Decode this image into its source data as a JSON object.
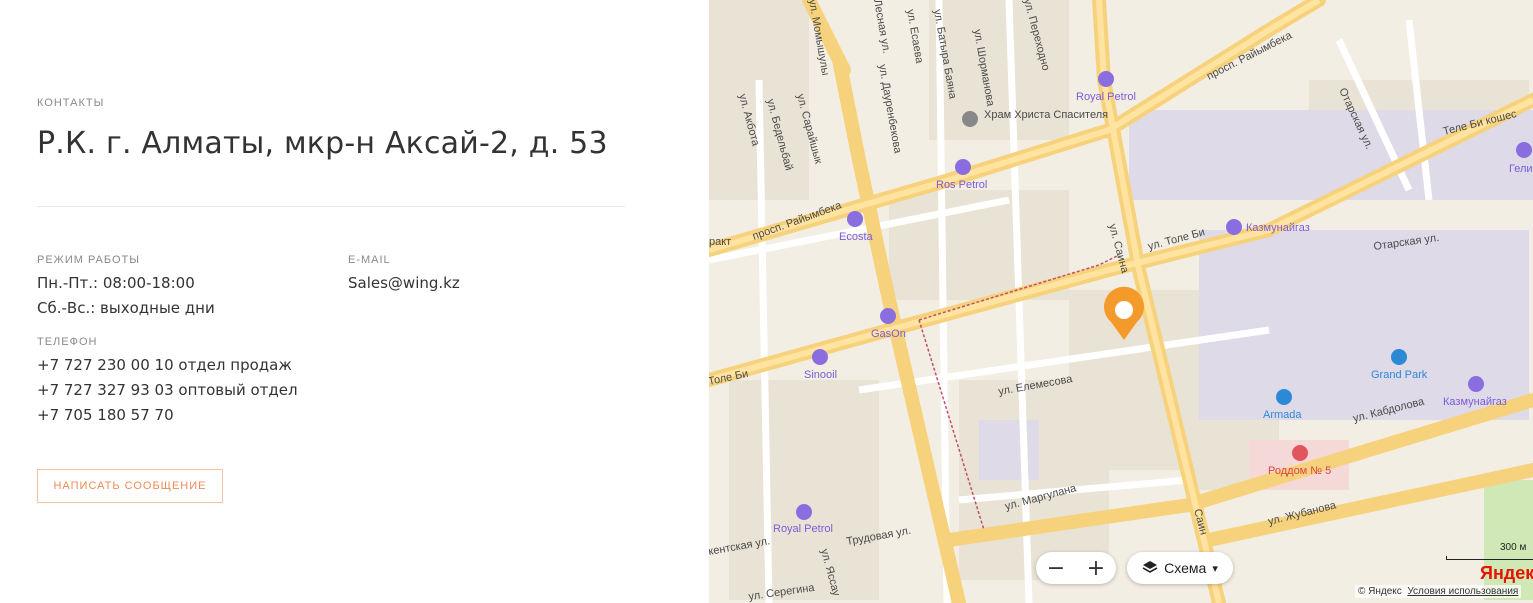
{
  "contacts": {
    "section_label": "КОНТАКТЫ",
    "address": "Р.К. г. Алматы, мкр-н Аксай-2, д. 53",
    "hours_label": "РЕЖИМ РАБОТЫ",
    "hours_lines": [
      "Пн.-Пт.: 08:00-18:00",
      "Сб.-Вс.: выходные дни"
    ],
    "email_label": "E-MAIL",
    "email": "Sales@wing.kz",
    "phone_label": "ТЕЛЕФОН",
    "phones": [
      "+7 727 230 00 10 отдел продаж",
      "+7 727 327 93 03 оптовый отдел",
      "+7 705 180 57 70"
    ],
    "message_button": "НАПИСАТЬ СООБЩЕНИЕ"
  },
  "map": {
    "streets": [
      "просп. Райымбека",
      "просп. Райымбека",
      "ракт",
      "ул. Толе Би",
      "Толе Би",
      "Теле Би кошес",
      "ул. Саина",
      "Саин",
      "ул. Елемесова",
      "ул. Маргулана",
      "ул. Жубанова",
      "ул. Кабдолова",
      "Отарская ул.",
      "Отарская ул.",
      "ул. Момышулы",
      "ул. Дауренбекова",
      "ул. Есаева",
      "ул. Батыра Баяна",
      "ул. Шорманова",
      "ул. Переходно",
      "ул. Акбота",
      "ул. Бедельбай",
      "ул. Сарайшык",
      "Лесная ул.",
      "Трудовая ул.",
      "ул. Яссау",
      "ул. Серегина",
      "кентская ул."
    ],
    "pois": [
      {
        "name": "Royal Petrol"
      },
      {
        "name": "Ros Petrol"
      },
      {
        "name": "Ecosta"
      },
      {
        "name": "GasOn"
      },
      {
        "name": "Sinooil"
      },
      {
        "name": "Казмунайгаз"
      },
      {
        "name": "Казмунайгаз"
      },
      {
        "name": "Grand Park"
      },
      {
        "name": "Armada"
      },
      {
        "name": "Роддом № 5"
      },
      {
        "name": "Royal Petrol"
      },
      {
        "name": "Гелио"
      },
      {
        "name": "Храм Христа Спасителя"
      }
    ],
    "zoom_out": "−",
    "zoom_in": "+",
    "layer_button": "Схема",
    "layer_arrow": "▾",
    "scale": "300 м",
    "copyright": "© Яндекс",
    "terms": "Условия использования",
    "logo": "Яндекс"
  }
}
